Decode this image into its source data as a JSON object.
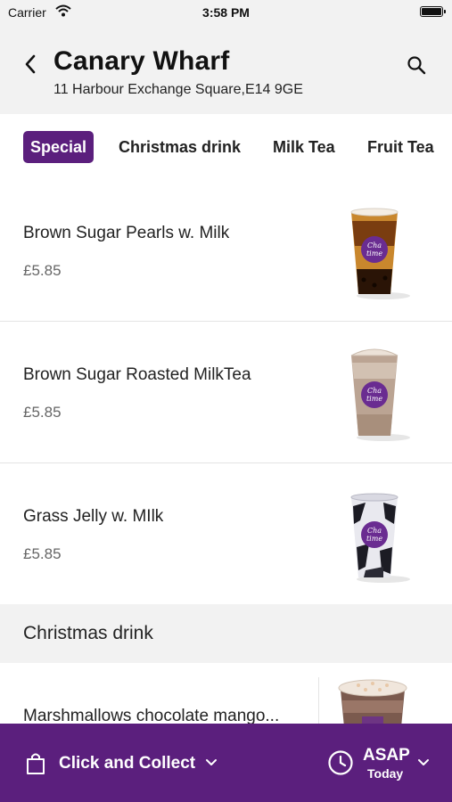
{
  "status_bar": {
    "carrier": "Carrier",
    "time": "3:58 PM"
  },
  "header": {
    "title": "Canary Wharf",
    "address": "11 Harbour Exchange Square,E14 9GE",
    "back_icon": "chevron-left-icon",
    "search_icon": "search-icon"
  },
  "category_tabs": [
    {
      "label": "Special",
      "active": true
    },
    {
      "label": "Christmas drink",
      "active": false
    },
    {
      "label": "Milk Tea",
      "active": false
    },
    {
      "label": "Fruit Tea",
      "active": false
    }
  ],
  "menu_items": [
    {
      "name": "Brown Sugar Pearls w. Milk",
      "price": "£5.85",
      "image": "brown-sugar-pearls-drink"
    },
    {
      "name": "Brown Sugar Roasted MilkTea",
      "price": "£5.85",
      "image": "roasted-milk-tea-drink"
    },
    {
      "name": "Grass Jelly w. MIlk",
      "price": "£5.85",
      "image": "grass-jelly-milk-drink"
    }
  ],
  "section": {
    "title": "Christmas drink"
  },
  "partial_item": {
    "name": "Marshmallows chocolate mango...",
    "image": "marshmallow-chocolate-drink"
  },
  "bottom_bar": {
    "mode_label": "Click and Collect",
    "time_label": "ASAP",
    "time_sub": "Today",
    "bag_icon": "shopping-bag-icon",
    "clock_icon": "clock-icon"
  },
  "colors": {
    "brand_purple": "#5b1f7d",
    "header_bg": "#f2f2f2",
    "cup_logo": "#6a2c91"
  }
}
